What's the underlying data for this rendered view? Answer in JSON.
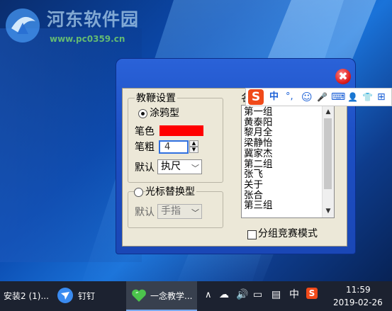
{
  "watermark": {
    "title": "河东软件园",
    "url": "www.pc0359.cn"
  },
  "dialog": {
    "close_symbol": "✖",
    "section_title": "教鞭设置",
    "mode_graffiti": "涂鸦型",
    "pen_color_label": "笔色",
    "pen_color": "#ff0000",
    "pen_width_label": "笔粗",
    "pen_width_value": "4",
    "default_label": "默认",
    "default_value": "执尺",
    "mode_cursor": "光标替换型",
    "default2_label": "默认",
    "default2_value": "手指",
    "list_title": "名",
    "list_items": [
      "第一组",
      "黄泰阳",
      "黎月全",
      "梁静怡",
      "冀家杰",
      "第二组",
      "张飞",
      "关于",
      "张合",
      "第三组"
    ],
    "group_race_label": "分组竞赛模式"
  },
  "ime": {
    "logo": "S",
    "items": [
      "中",
      "°,",
      "☺",
      "🎤",
      "⌨",
      "👤",
      "👕",
      "⊞"
    ]
  },
  "taskbar": {
    "items": [
      "安装2 (1)...",
      "钉钉",
      "一念教学..."
    ],
    "tray": {
      "lang": "中",
      "ime_logo": "S",
      "time": "11:59",
      "date": "2019-02-26"
    }
  }
}
